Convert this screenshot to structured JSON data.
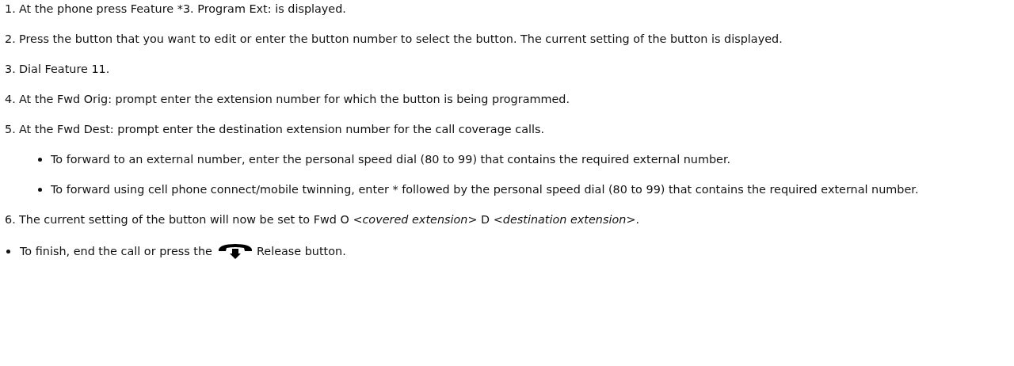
{
  "steps": [
    {
      "number": "1.",
      "text": "At the phone press Feature *3. Program Ext: is displayed."
    },
    {
      "number": "2.",
      "text": "Press the button that you want to edit or enter the button number to select the button. The current setting of the button is displayed."
    },
    {
      "number": "3.",
      "text": "Dial Feature 11."
    },
    {
      "number": "4.",
      "text": "At the Fwd Orig: prompt enter the extension number for which the button is being programmed."
    },
    {
      "number": "5.",
      "text": "At the Fwd Dest: prompt enter the destination extension number for the call coverage calls.",
      "bullets": [
        "To forward to an external number, enter the personal speed dial (80 to 99) that contains the required external number.",
        "To forward using cell phone connect/mobile twinning, enter * followed by the personal speed dial (80 to 99) that contains the required external number."
      ]
    },
    {
      "number": "6.",
      "text": "The current setting of the button will now be set to Fwd O *<covered extension>* D *<destination extension>*."
    }
  ],
  "final_bullet": {
    "text_before": "To finish, end the call or press the",
    "text_after": "Release button."
  }
}
